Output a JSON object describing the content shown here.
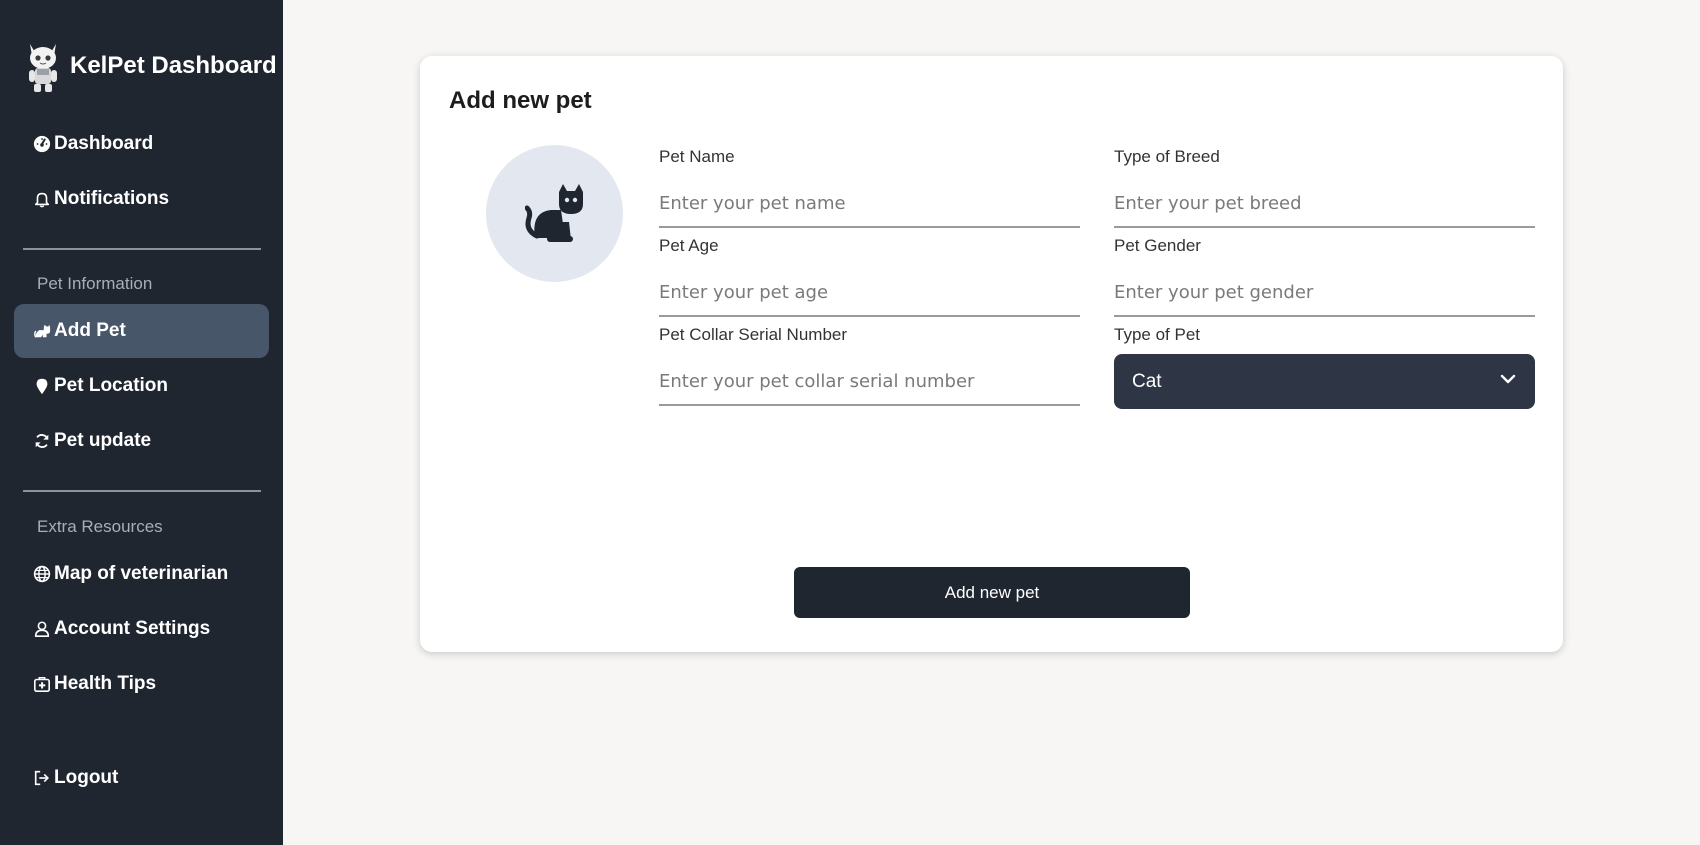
{
  "sidebar": {
    "brand_title": "KelPet Dashboard",
    "logo_icon": "cat-mascot-icon",
    "items": [
      {
        "label": "Dashboard",
        "icon": "gauge-icon"
      },
      {
        "label": "Notifications",
        "icon": "bell-icon"
      },
      {
        "label": "Add Pet",
        "icon": "cat-icon",
        "active": true
      },
      {
        "label": "Pet Location",
        "icon": "map-pin-icon"
      },
      {
        "label": "Pet update",
        "icon": "refresh-icon"
      },
      {
        "label": "Map of veterinarian",
        "icon": "globe-icon"
      },
      {
        "label": "Account Settings",
        "icon": "user-icon"
      },
      {
        "label": "Health Tips",
        "icon": "medkit-icon"
      },
      {
        "label": "Logout",
        "icon": "logout-icon"
      }
    ],
    "sections": {
      "pet_information": "Pet Information",
      "extra_resources": "Extra Resources"
    }
  },
  "form": {
    "title": "Add new pet",
    "avatar_icon": "cat-icon",
    "fields": {
      "pet_name": {
        "label": "Pet Name",
        "placeholder": "Enter your pet name",
        "value": ""
      },
      "breed": {
        "label": "Type of Breed",
        "placeholder": "Enter your pet breed",
        "value": ""
      },
      "age": {
        "label": "Pet Age",
        "placeholder": "Enter your pet age",
        "value": ""
      },
      "gender": {
        "label": "Pet Gender",
        "placeholder": "Enter your pet gender",
        "value": ""
      },
      "collar": {
        "label": "Pet Collar Serial Number",
        "placeholder": "Enter your pet collar serial number",
        "value": ""
      },
      "pet_type": {
        "label": "Type of Pet",
        "selected": "Cat"
      }
    },
    "submit_label": "Add new pet"
  },
  "colors": {
    "sidebar_bg": "#1f2630",
    "active_item_bg": "#48566a",
    "select_bg": "#2e3645",
    "button_bg": "#1f2630",
    "page_bg": "#f7f6f4",
    "avatar_bg": "#e3e7ef"
  }
}
